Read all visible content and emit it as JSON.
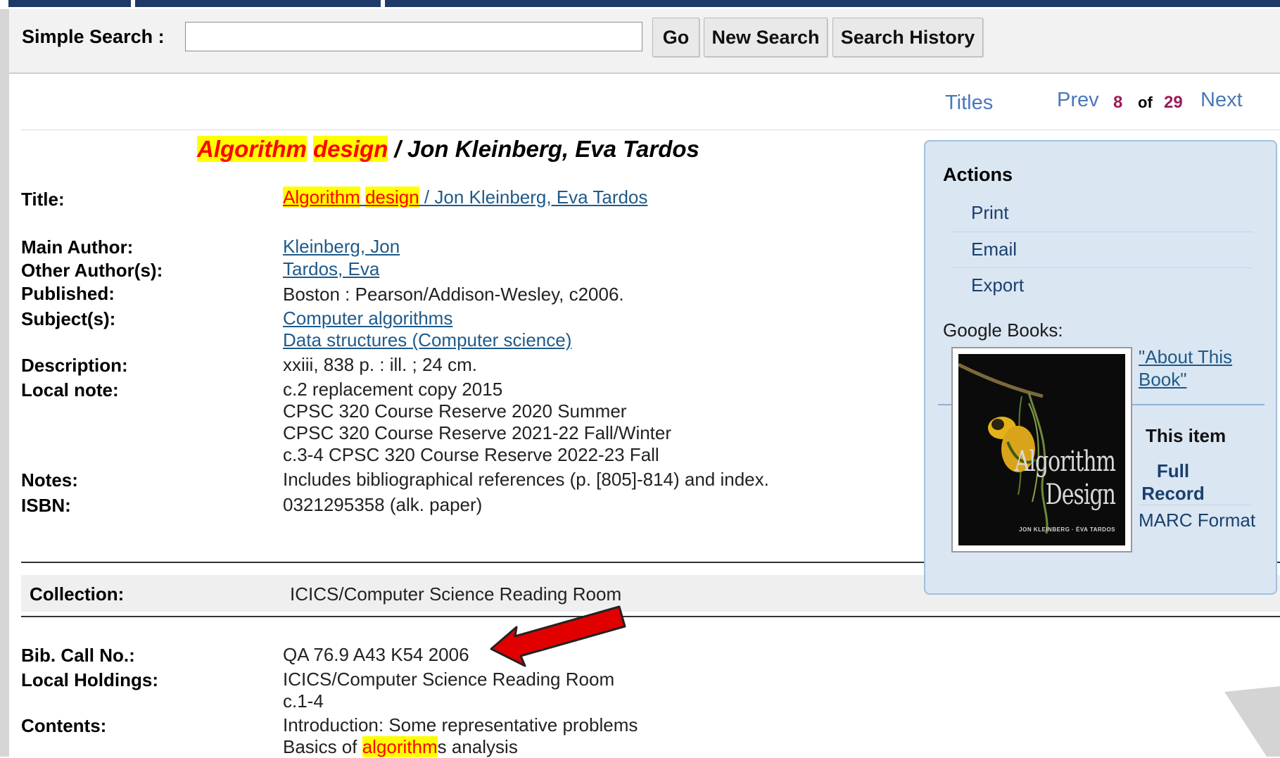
{
  "search": {
    "label": "Simple Search :",
    "value": "",
    "placeholder": "",
    "go_label": "Go",
    "new_search_label": "New Search",
    "history_label": "Search History"
  },
  "nav": {
    "titles_label": "Titles",
    "prev_label": "Prev",
    "current": "8",
    "of_label": "of",
    "total": "29",
    "next_label": "Next"
  },
  "record": {
    "heading_hl1": "Algorithm",
    "heading_hl2": "design",
    "heading_rest": " / Jon Kleinberg, Eva Tardos",
    "fields": {
      "title_label": "Title:",
      "title_hl1": "Algorithm",
      "title_hl2": "design",
      "title_rest": " / Jon Kleinberg, Eva Tardos",
      "main_author_label": "Main Author:",
      "main_author": "Kleinberg, Jon",
      "other_authors_label": "Other Author(s):",
      "other_authors": "Tardos, Eva",
      "published_label": "Published:",
      "published": "Boston : Pearson/Addison-Wesley, c2006.",
      "subjects_label": "Subject(s):",
      "subjects": [
        "Computer algorithms",
        "Data structures (Computer science)"
      ],
      "description_label": "Description:",
      "description": "xxiii, 838 p. : ill. ; 24 cm.",
      "local_note_label": "Local note:",
      "local_notes": [
        "c.2 replacement copy 2015",
        "CPSC 320 Course Reserve 2020 Summer",
        "CPSC 320 Course Reserve 2021-22 Fall/Winter",
        "c.3-4 CPSC 320 Course Reserve 2022-23 Fall"
      ],
      "notes_label": "Notes:",
      "notes": "Includes bibliographical references (p. [805]-814) and index.",
      "isbn_label": "ISBN:",
      "isbn": "0321295358 (alk. paper)"
    },
    "collection_label": "Collection:",
    "collection": "ICICS/Computer Science Reading Room",
    "call_no_label": "Bib. Call No.:",
    "call_no": "QA 76.9 A43 K54 2006",
    "local_holdings_label": "Local Holdings:",
    "local_holdings": [
      "ICICS/Computer Science Reading Room",
      "c.1-4"
    ],
    "contents_label": "Contents:",
    "contents_1": "Introduction: Some representative problems",
    "contents_2_pre": "Basics of ",
    "contents_2_hl": "algorithm",
    "contents_2_post": "s analysis"
  },
  "actions": {
    "title": "Actions",
    "items": [
      "Print",
      "Email",
      "Export"
    ],
    "google_books_label": "Google Books:",
    "cover_title": "Algorithm Design",
    "cover_authors": "JON KLEINBERG · ÉVA TARDOS",
    "about_link": "\"About This Book\"",
    "this_item_label": "This item",
    "full_record_label": "Full Record",
    "marc_label": "MARC Format"
  },
  "colors": {
    "accent_link": "#1f5a8a",
    "nav_link": "#4a78b8",
    "highlight_bg": "#ffff00",
    "highlight_text": "#ff0000",
    "panel_bg": "#dae6f2",
    "arrow": "#e00000"
  }
}
